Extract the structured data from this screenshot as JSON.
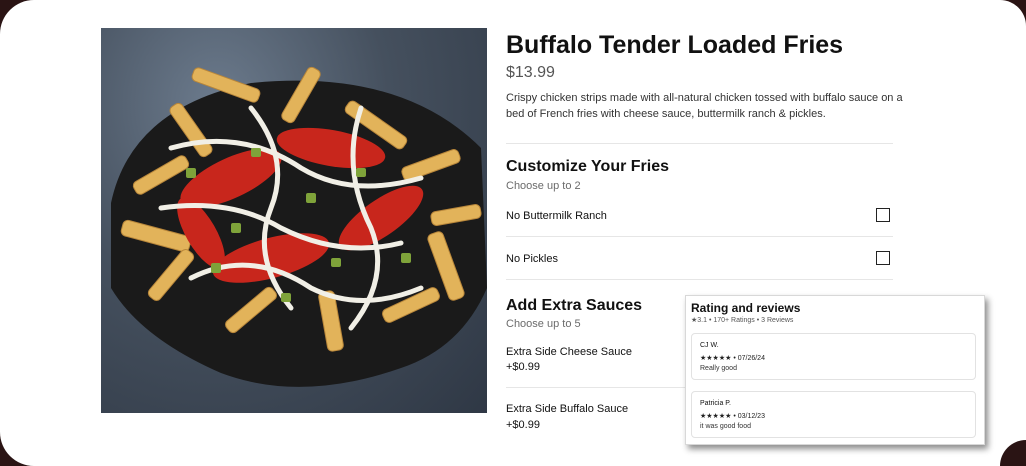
{
  "item": {
    "title": "Buffalo Tender Loaded Fries",
    "price": "$13.99",
    "description": "Crispy chicken strips made with all-natural chicken tossed with buffalo sauce on a bed of French fries with cheese sauce, buttermilk ranch & pickles."
  },
  "customize": {
    "title": "Customize Your Fries",
    "subtitle": "Choose up to 2",
    "options": [
      {
        "label": "No Buttermilk Ranch",
        "checked": false
      },
      {
        "label": "No Pickles",
        "checked": false
      }
    ]
  },
  "sauces": {
    "title": "Add Extra Sauces",
    "subtitle": "Choose up to 5",
    "options": [
      {
        "label": "Extra Side Cheese Sauce",
        "price": "+$0.99"
      },
      {
        "label": "Extra Side Buffalo Sauce",
        "price": "+$0.99"
      }
    ]
  },
  "reviews": {
    "title": "Rating and reviews",
    "summary": "★3.1 • 170+ Ratings • 3 Reviews",
    "items": [
      {
        "name": "CJ W.",
        "stars": "★★★★★ • 07/26/24",
        "text": "Really good"
      },
      {
        "name": "Patricia P.",
        "stars": "★★★★★ • 03/12/23",
        "text": "it was good food"
      }
    ]
  },
  "colors": {
    "frame": "#2a1414",
    "sauce": "#c8261c",
    "ranch": "#f1efe6",
    "fries": "#e2b35a"
  }
}
